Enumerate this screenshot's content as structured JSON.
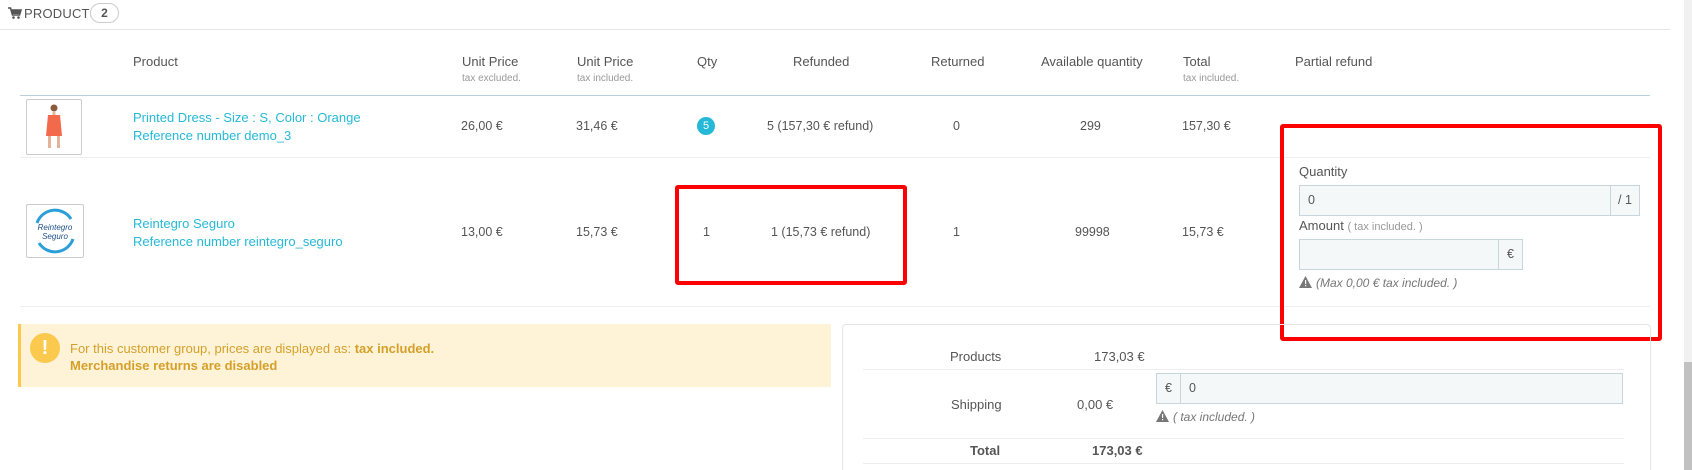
{
  "panel": {
    "title": "PRODUCTS",
    "count": "2"
  },
  "table": {
    "headers": {
      "product": "Product",
      "unit_price_excl": "Unit Price",
      "unit_price_excl_sub": "tax excluded.",
      "unit_price_incl": "Unit Price",
      "unit_price_incl_sub": "tax included.",
      "qty": "Qty",
      "refunded": "Refunded",
      "returned": "Returned",
      "available": "Available quantity",
      "total": "Total",
      "total_sub": "tax included.",
      "partial_refund": "Partial refund"
    },
    "rows": [
      {
        "name": "Printed Dress - Size : S, Color : Orange",
        "reference": "Reference number demo_3",
        "unit_price_excl": "26,00 €",
        "unit_price_incl": "31,46 €",
        "qty": "5",
        "refunded": "5 (157,30 € refund)",
        "returned": "0",
        "available": "299",
        "total": "157,30 €"
      },
      {
        "name": "Reintegro Seguro",
        "reference": "Reference number reintegro_seguro",
        "thumb_text": "Reintegro Seguro",
        "unit_price_excl": "13,00 €",
        "unit_price_incl": "15,73 €",
        "qty": "1",
        "refunded": "1 (15,73 € refund)",
        "returned": "1",
        "available": "99998",
        "total": "15,73 €"
      }
    ]
  },
  "partial_refund": {
    "quantity_label": "Quantity",
    "quantity_value": "0",
    "quantity_max": "/ 1",
    "amount_label": "Amount",
    "amount_sub": "( tax included. )",
    "amount_value": "",
    "currency": "€",
    "max_note": "(Max 0,00 € tax included. )"
  },
  "alert": {
    "line1_prefix": "For this customer group, prices are displayed as:",
    "line1_bold": "tax included.",
    "line2": "Merchandise returns are disabled"
  },
  "totals": {
    "products_label": "Products",
    "products_value": "173,03 €",
    "shipping_label": "Shipping",
    "shipping_value": "0,00 €",
    "shipping_currency": "€",
    "shipping_input": "0",
    "shipping_note": "( tax included. )",
    "total_label": "Total",
    "total_value": "173,03 €"
  },
  "colors": {
    "accent": "#25b9d7",
    "warning_bg": "#fff3d7",
    "warning_text": "#d5a02a",
    "highlight": "#ff0000"
  }
}
